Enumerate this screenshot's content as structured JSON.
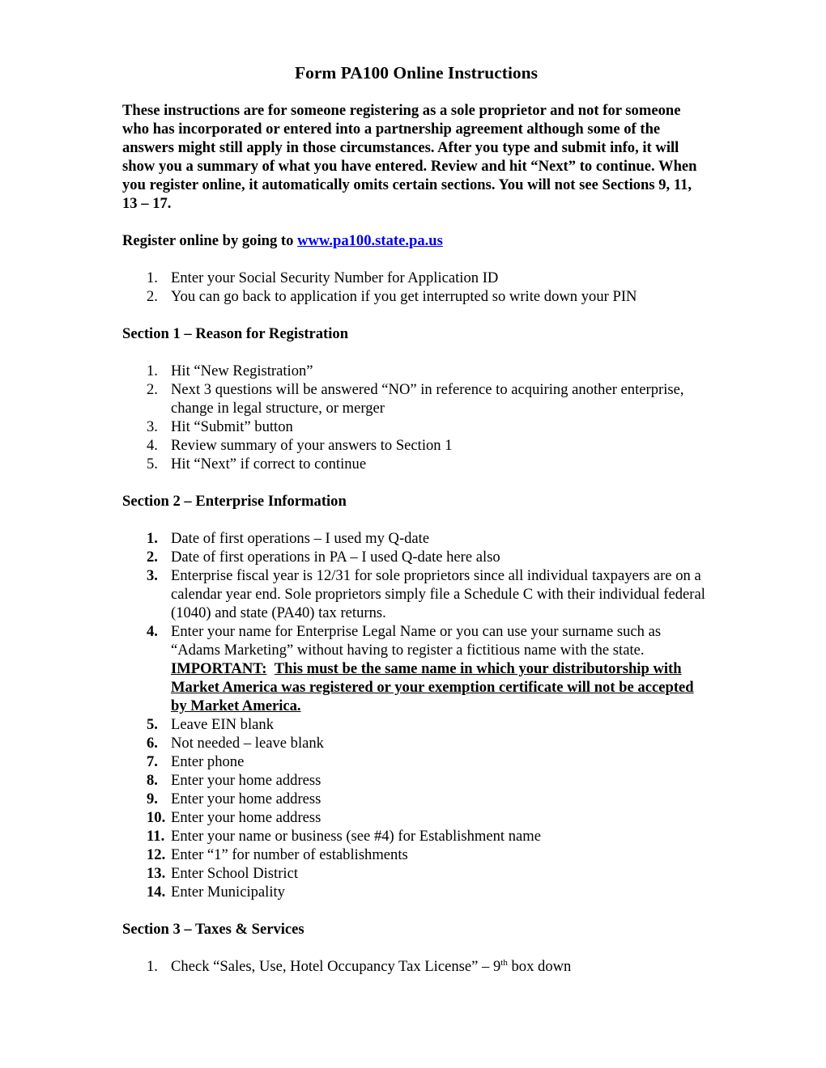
{
  "document": {
    "title": "Form PA100 Online Instructions",
    "intro": "These instructions are for someone registering as a sole proprietor and not for someone who has incorporated or entered into a partnership agreement although some of the answers might still apply in those circumstances.  After you type and submit info, it will show you a summary of what you have entered.  Review and hit “Next” to continue.  When you register online, it automatically omits certain sections.  You will not see Sections 9, 11, 13 – 17.",
    "register": {
      "prefix": "Register online by going to ",
      "link_text": "www.pa100.state.pa.us",
      "link_color": "#0000ee"
    },
    "intro_steps": [
      {
        "num": "1.",
        "text": "Enter your Social Security Number for Application ID"
      },
      {
        "num": "2.",
        "text": "You can go back to application if you get interrupted so write down your PIN"
      }
    ],
    "section1": {
      "heading": "Section 1 – Reason for Registration",
      "items": [
        {
          "num": "1.",
          "text": "Hit “New Registration”"
        },
        {
          "num": "2.",
          "text": "Next 3 questions will be answered “NO” in reference to acquiring another enterprise, change in legal structure, or merger"
        },
        {
          "num": "3.",
          "text": "Hit “Submit” button"
        },
        {
          "num": "4.",
          "text": "Review summary of your answers to Section 1"
        },
        {
          "num": "5.",
          "text": "Hit “Next” if correct to continue"
        }
      ]
    },
    "section2": {
      "heading": "Section 2 – Enterprise Information",
      "items": [
        {
          "num": "1.",
          "text": "Date of first operations – I used my Q-date"
        },
        {
          "num": "2.",
          "text": "Date of first operations in PA – I used Q-date here also"
        },
        {
          "num": "3.",
          "text": "Enterprise fiscal year is 12/31 for sole proprietors since all individual taxpayers are on a calendar year end.  Sole proprietors simply file a Schedule C with their individual federal (1040) and state (PA40) tax returns."
        },
        {
          "num": "4.",
          "text": "Enter your name for Enterprise Legal Name or you can use your surname such as “Adams Marketing” without having to register a fictitious name with the state.",
          "important_label": "IMPORTANT:",
          "important_text": "This must be the same name in which your distributorship with Market America was registered or your exemption certificate will not be accepted by Market America. "
        },
        {
          "num": "5.",
          "text": "Leave EIN blank"
        },
        {
          "num": "6.",
          "text": "Not needed – leave blank"
        },
        {
          "num": "7.",
          "text": "Enter phone"
        },
        {
          "num": "8.",
          "text": "Enter your home address"
        },
        {
          "num": "9.",
          "text": "Enter your home address"
        },
        {
          "num": "10.",
          "text": "Enter your home address"
        },
        {
          "num": "11.",
          "text": "Enter your name or business (see #4) for Establishment name"
        },
        {
          "num": "12.",
          "text": "Enter “1” for number of establishments"
        },
        {
          "num": "13.",
          "text": "Enter School District"
        },
        {
          "num": "14.",
          "text": "Enter Municipality"
        }
      ]
    },
    "section3": {
      "heading": "Section 3 – Taxes & Services",
      "items": [
        {
          "num": "1.",
          "text_before": "Check “Sales, Use, Hotel Occupancy Tax License” – 9",
          "sup": "th",
          "text_after": " box down"
        }
      ]
    }
  }
}
